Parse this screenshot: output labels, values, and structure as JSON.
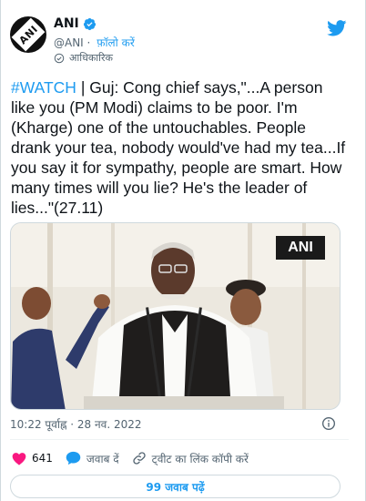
{
  "account": {
    "display_name": "ANI",
    "handle": "@ANI",
    "separator": " · ",
    "follow_label": "फ़ॉलो करें",
    "official_label": "आधिकारिक",
    "avatar_text": "ANI"
  },
  "tweet": {
    "hashtag": "#WATCH",
    "body": " | Guj: Cong chief says,\"...A person like you (PM Modi) claims to be poor. I'm (Kharge) one of the untouchables. People drank your tea, nobody would've had my tea...If you say it for sympathy, people are smart. How many times will you lie? He's the leader of lies...\"(27.11)",
    "media_watermark": "ANI",
    "timestamp": "10:22 पूर्वाह्न · 28 नव. 2022"
  },
  "actions": {
    "like_count": "641",
    "reply_label": "जवाब दें",
    "copy_link_label": "ट्वीट का लिंक कॉपी करें"
  },
  "replies_button": "99 जवाब पढ़ें",
  "colors": {
    "accent": "#1d9bf0",
    "like": "#f91880",
    "text": "#0f1419",
    "muted": "#536471"
  },
  "icons": [
    "verified-icon",
    "official-icon",
    "twitter-logo-icon",
    "info-icon",
    "heart-icon",
    "reply-icon",
    "link-icon"
  ]
}
